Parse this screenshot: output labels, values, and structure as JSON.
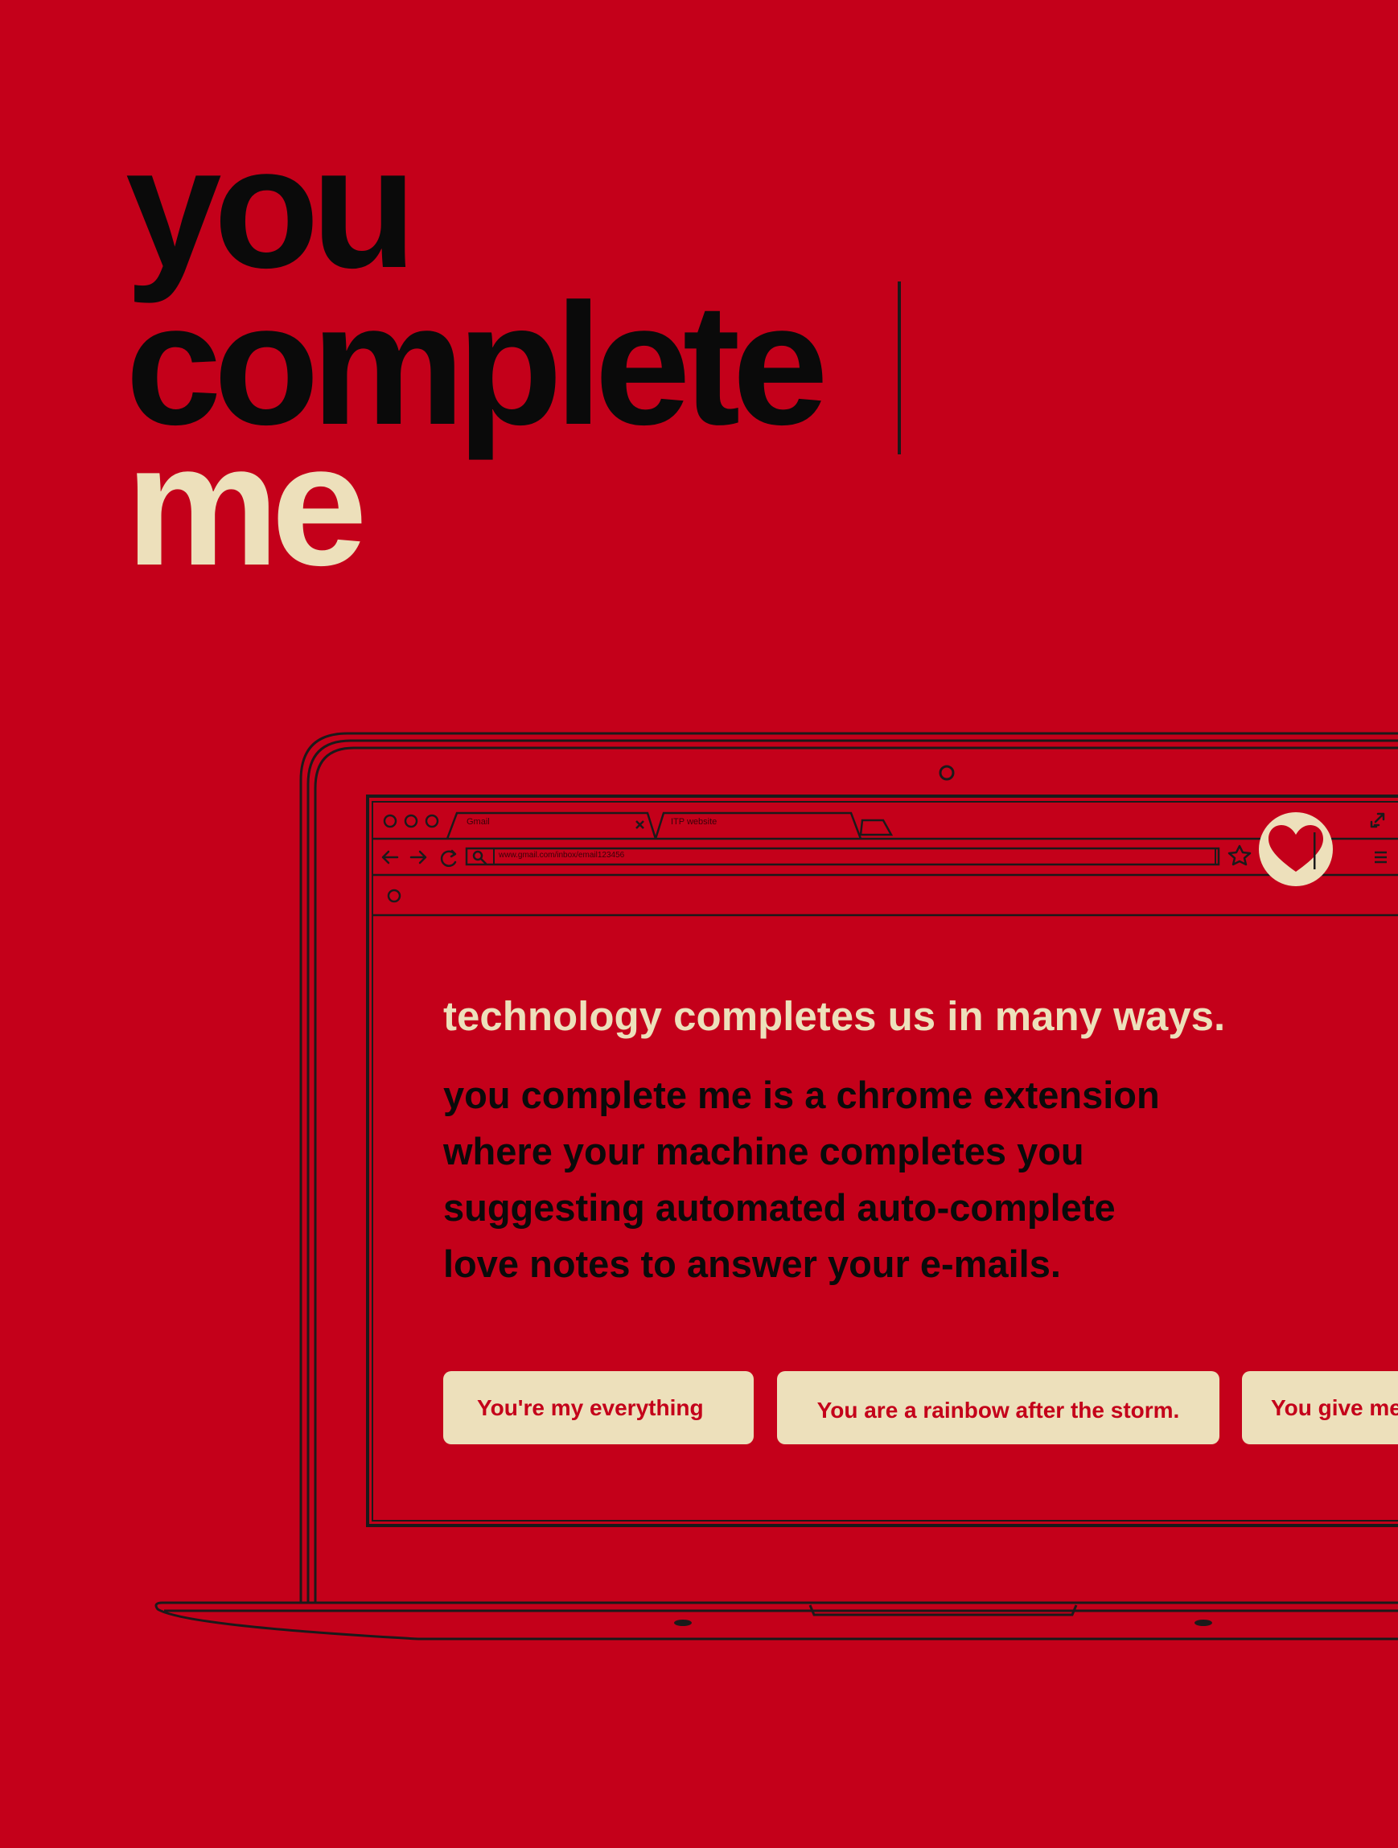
{
  "headline": {
    "line1": "you",
    "line2": "complete",
    "line3": "me"
  },
  "browser": {
    "tabs": [
      {
        "label": "Gmail"
      },
      {
        "label": "ITP website"
      }
    ],
    "url": "www.gmail.com/inbox/email123456"
  },
  "content": {
    "tagline": "technology completes us in many ways.",
    "description": [
      "you complete me is a chrome extension",
      "where your machine completes you",
      "suggesting automated auto-complete",
      "love notes to answer your e-mails."
    ]
  },
  "suggestions": [
    "You're my everything",
    "You are a rainbow after the storm.",
    "You give me"
  ],
  "icons": {
    "extension": "heart-icon",
    "back": "arrow-left-icon",
    "forward": "arrow-right-icon",
    "reload": "reload-icon",
    "search": "search-icon",
    "bookmark": "star-icon",
    "menu": "hamburger-icon",
    "fullscreen": "expand-icon",
    "webcam": "webcam-icon"
  },
  "colors": {
    "background": "#c4001a",
    "cream": "#ede0bb",
    "ink": "#0a0a0a"
  }
}
